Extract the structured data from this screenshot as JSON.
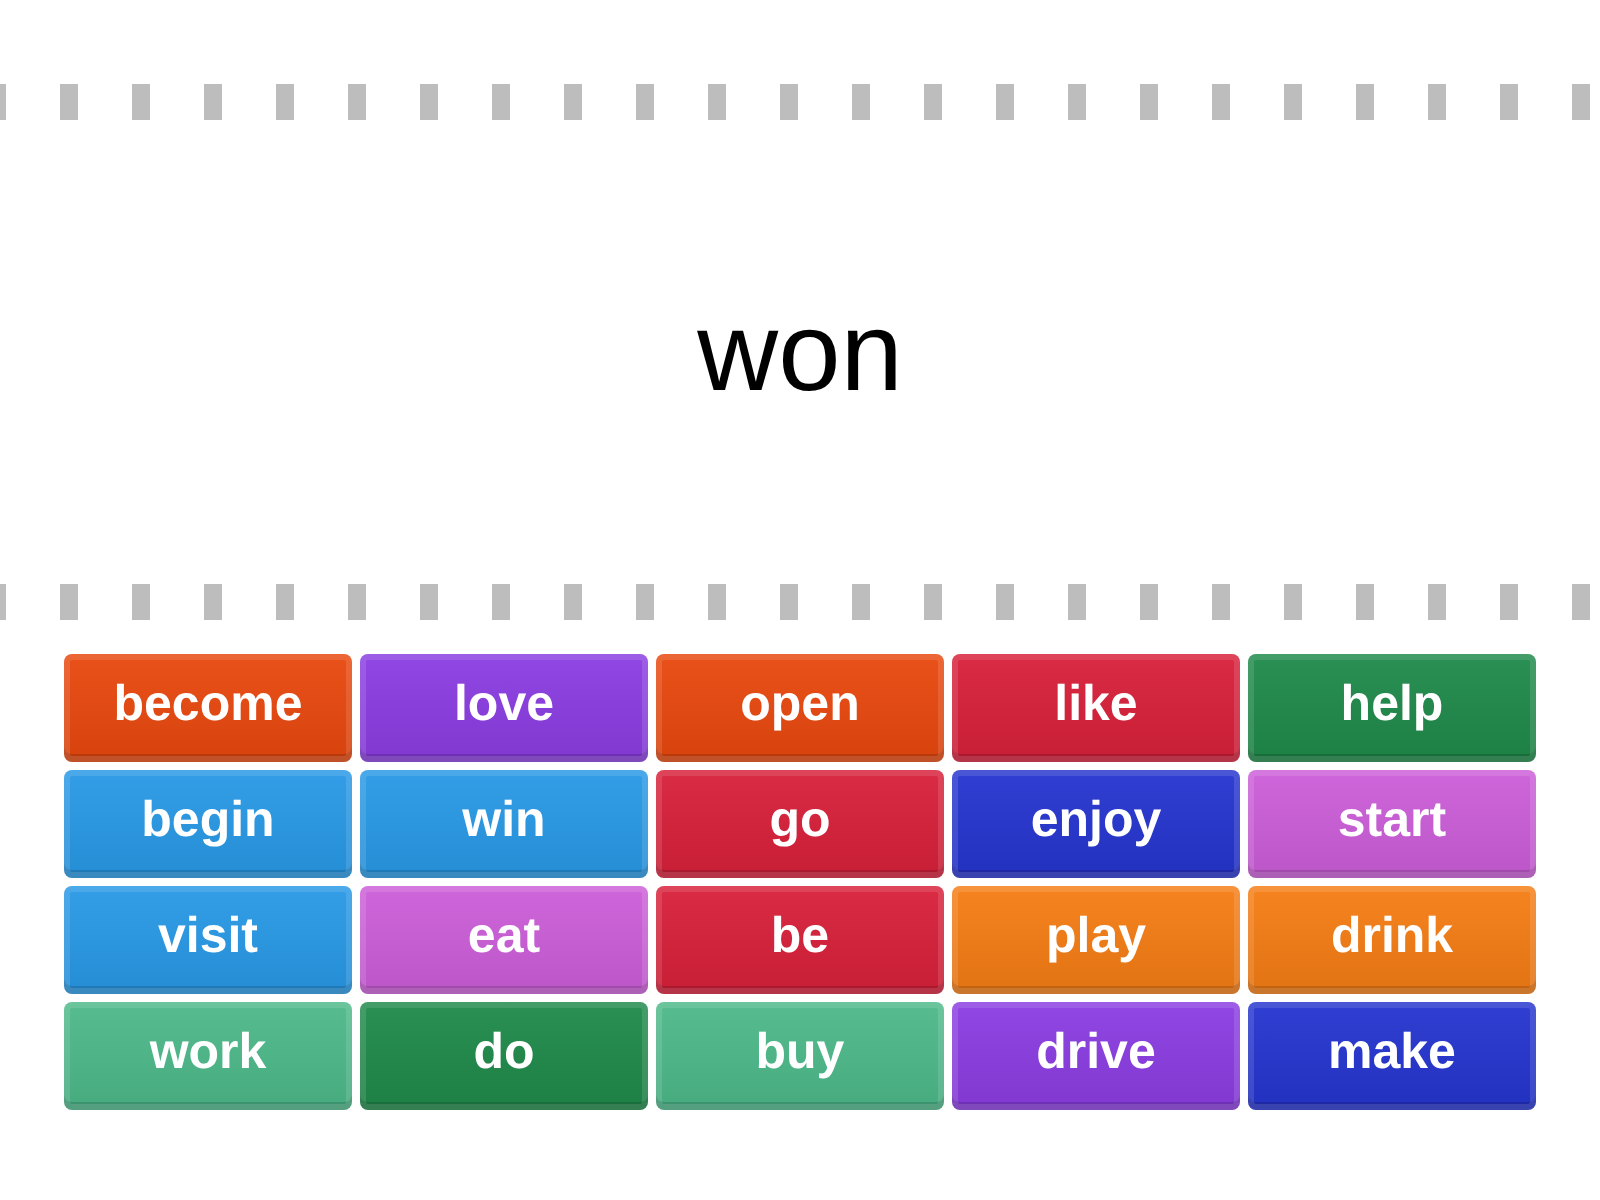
{
  "prompt": {
    "text": "won"
  },
  "tiles": [
    {
      "text": "become",
      "color": "#e9480e"
    },
    {
      "text": "love",
      "color": "#8b3de2"
    },
    {
      "text": "open",
      "color": "#e9480e"
    },
    {
      "text": "like",
      "color": "#d8203a"
    },
    {
      "text": "help",
      "color": "#1f8a4a"
    },
    {
      "text": "begin",
      "color": "#2899e6"
    },
    {
      "text": "win",
      "color": "#2899e6"
    },
    {
      "text": "go",
      "color": "#d8203a"
    },
    {
      "text": "enjoy",
      "color": "#2535cf"
    },
    {
      "text": "start",
      "color": "#cc5ed9"
    },
    {
      "text": "visit",
      "color": "#2899e6"
    },
    {
      "text": "eat",
      "color": "#cc5ed9"
    },
    {
      "text": "be",
      "color": "#d8203a"
    },
    {
      "text": "play",
      "color": "#f57d14"
    },
    {
      "text": "drink",
      "color": "#f57d14"
    },
    {
      "text": "work",
      "color": "#4db98a"
    },
    {
      "text": "do",
      "color": "#1f8a4a"
    },
    {
      "text": "buy",
      "color": "#4db98a"
    },
    {
      "text": "drive",
      "color": "#8b3de2"
    },
    {
      "text": "make",
      "color": "#2535cf"
    }
  ]
}
